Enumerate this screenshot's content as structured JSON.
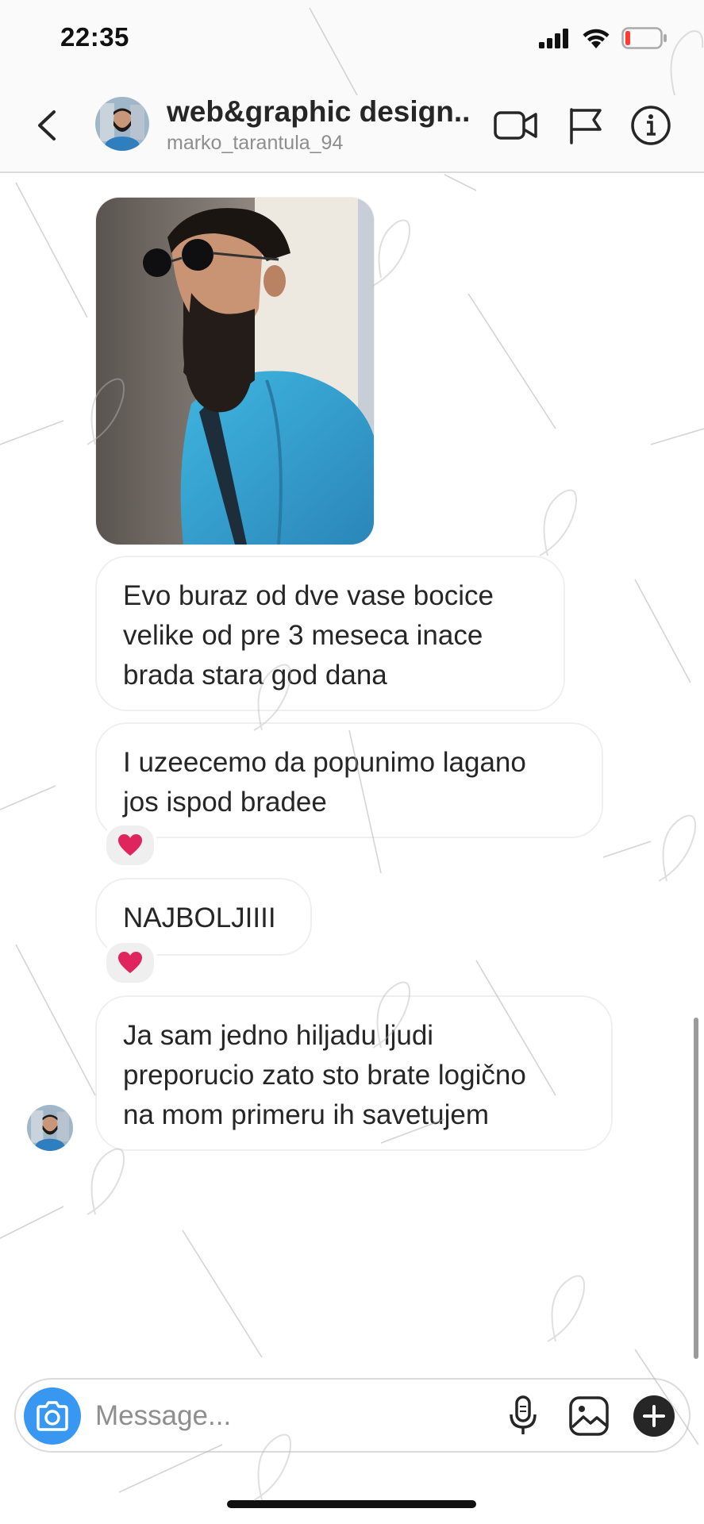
{
  "status_bar": {
    "time": "22:35",
    "icons": [
      "signal-icon",
      "wifi-icon",
      "battery-icon"
    ],
    "battery_color": "#ff3b30"
  },
  "header": {
    "title": "web&graphic design...",
    "subtitle": "marko_tarantula_94",
    "icons": [
      "back-chevron-icon",
      "video-call-icon",
      "flag-icon",
      "info-icon"
    ]
  },
  "messages": [
    {
      "type": "photo",
      "alt_icon": "photo-message"
    },
    {
      "type": "text",
      "lines": [
        "Evo buraz od dve vase bocice",
        "velike od pre 3 meseca inace",
        "brada stara god dana"
      ]
    },
    {
      "type": "text",
      "lines": [
        "I uzeecemo da popunimo lagano",
        "jos ispod bradee"
      ],
      "reaction": "❤️"
    },
    {
      "type": "text",
      "lines": [
        "NAJBOLJIIII"
      ],
      "reaction": "❤️"
    },
    {
      "type": "text",
      "lines": [
        "Ja sam jedno hiljadu ljudi",
        "preporucio zato sto brate logično",
        "na mom primeru ih savetujem"
      ]
    }
  ],
  "composer": {
    "placeholder": "Message...",
    "icons": [
      "camera-icon",
      "microphone-icon",
      "gallery-icon",
      "plus-icon"
    ],
    "camera_color": "#3897f0"
  },
  "colors": {
    "bubble_border": "#efefef",
    "text": "#262626",
    "muted": "#8e8e8e",
    "heart": "#e0245e"
  }
}
